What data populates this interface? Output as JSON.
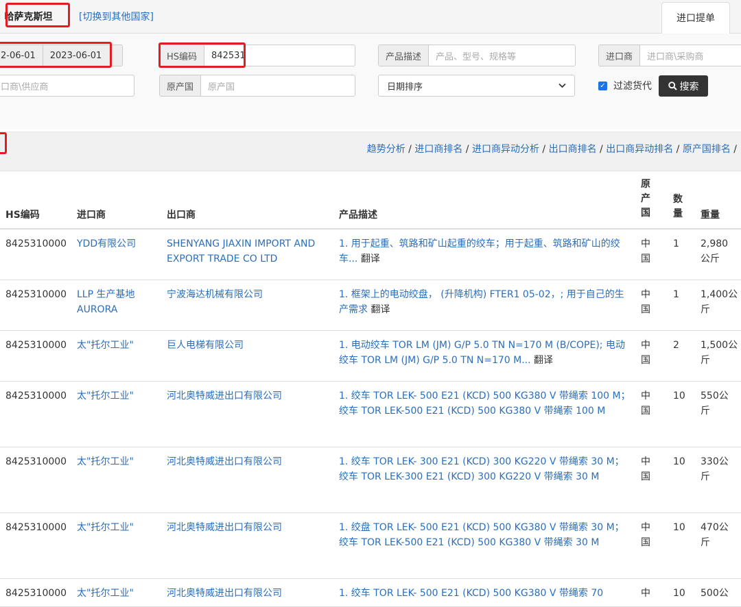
{
  "header": {
    "country": "哈萨克斯坦",
    "switch_country": "[切换到其他国家]",
    "tab_import": "进口提单"
  },
  "form": {
    "date_from": "2-06-01",
    "date_to": "2023-06-01",
    "hs_label": "HS编码",
    "hs_value": "842531",
    "desc_label": "产品描述",
    "desc_placeholder": "产品、型号、规格等",
    "importer_label": "进口商",
    "importer_placeholder": "进口商\\采购商",
    "exporter_placeholder": "口商\\供应商",
    "origin_label": "原产国",
    "origin_placeholder": "原产国",
    "sort_value": "日期排序",
    "filter_label": "过滤货代",
    "search_label": "搜索"
  },
  "analysis": {
    "links": [
      "趋势分析",
      "进口商排名",
      "进口商异动分析",
      "出口商排名",
      "出口商异动排名",
      "原产国排名"
    ],
    "sep": " / ",
    "trailing": " /"
  },
  "table": {
    "headers": {
      "hs": "HS编码",
      "importer": "进口商",
      "exporter": "出口商",
      "desc": "产品描述",
      "origin": "原\n产\n国",
      "qty": "数\n量",
      "weight": "重量"
    },
    "translate": "翻译",
    "rows": [
      {
        "hs": "8425310000",
        "importer": "YDD有限公司",
        "exporter": "SHENYANG JIAXIN IMPORT AND EXPORT TRADE CO LTD",
        "desc": "1. 用于起重、筑路和矿山起重的绞车；用于起重、筑路和矿山的绞车...",
        "translate": true,
        "origin": "中\n国",
        "qty": "1",
        "weight": "2,980\n公斤"
      },
      {
        "hs": "8425310000",
        "importer": "LLP 生产基地 AURORA",
        "exporter": "宁波海达机械有限公司",
        "desc": "1. 框架上的电动绞盘， (升降机构) FTER1 05-02，; 用于自己的生产需求",
        "translate": true,
        "origin": "中\n国",
        "qty": "1",
        "weight": "1,400公\n斤"
      },
      {
        "hs": "8425310000",
        "importer": "太\"托尔工业\"",
        "exporter": "巨人电梯有限公司",
        "desc": "1. 电动绞车 TOR LM (JM) G/P 5.0 TN N=170 M (B/COPE); 电动绞车 TOR LM (JM) G/P 5.0 TN N=170 M...",
        "translate": true,
        "origin": "中\n国",
        "qty": "2",
        "weight": "1,500公\n斤"
      },
      {
        "hs": "8425310000",
        "importer": "太\"托尔工业\"",
        "exporter": "河北奥特威进出口有限公司",
        "desc": "1. 绞车 TOR LEK- 500 E21 (KCD) 500 KG380 V 带绳索 100 M；绞车 TOR LEK-500 E21 (KCD) 500 KG380 V 带绳索 100 M",
        "translate": false,
        "origin": "中\n国",
        "qty": "10",
        "weight": "550公\n斤"
      },
      {
        "hs": "8425310000",
        "importer": "太\"托尔工业\"",
        "exporter": "河北奥特威进出口有限公司",
        "desc": "1. 绞车 TOR LEK- 300 E21 (KCD) 300 KG220 V 带绳索 30 M；绞车 TOR LEK-300 E21 (KCD) 300 KG220 V 带绳索 30 M",
        "translate": false,
        "origin": "中\n国",
        "qty": "10",
        "weight": "330公\n斤"
      },
      {
        "hs": "8425310000",
        "importer": "太\"托尔工业\"",
        "exporter": "河北奥特威进出口有限公司",
        "desc": "1. 绞盘 TOR LEK- 500 E21 (KCD) 500 KG380 V 带绳索 30 M；绞车 TOR LEK-500 E21 (KCD) 500 KG380 V 带绳索 30 M",
        "translate": false,
        "origin": "中\n国",
        "qty": "10",
        "weight": "470公\n斤"
      },
      {
        "hs": "8425310000",
        "importer": "太\"托尔工业\"",
        "exporter": "河北奥特威进出口有限公司",
        "desc": "1. 绞车 TOR LEK- 500 E21 (KCD) 500 KG380 V 带绳索 70",
        "translate": false,
        "origin": "中",
        "qty": "10",
        "weight": "500公"
      }
    ]
  }
}
